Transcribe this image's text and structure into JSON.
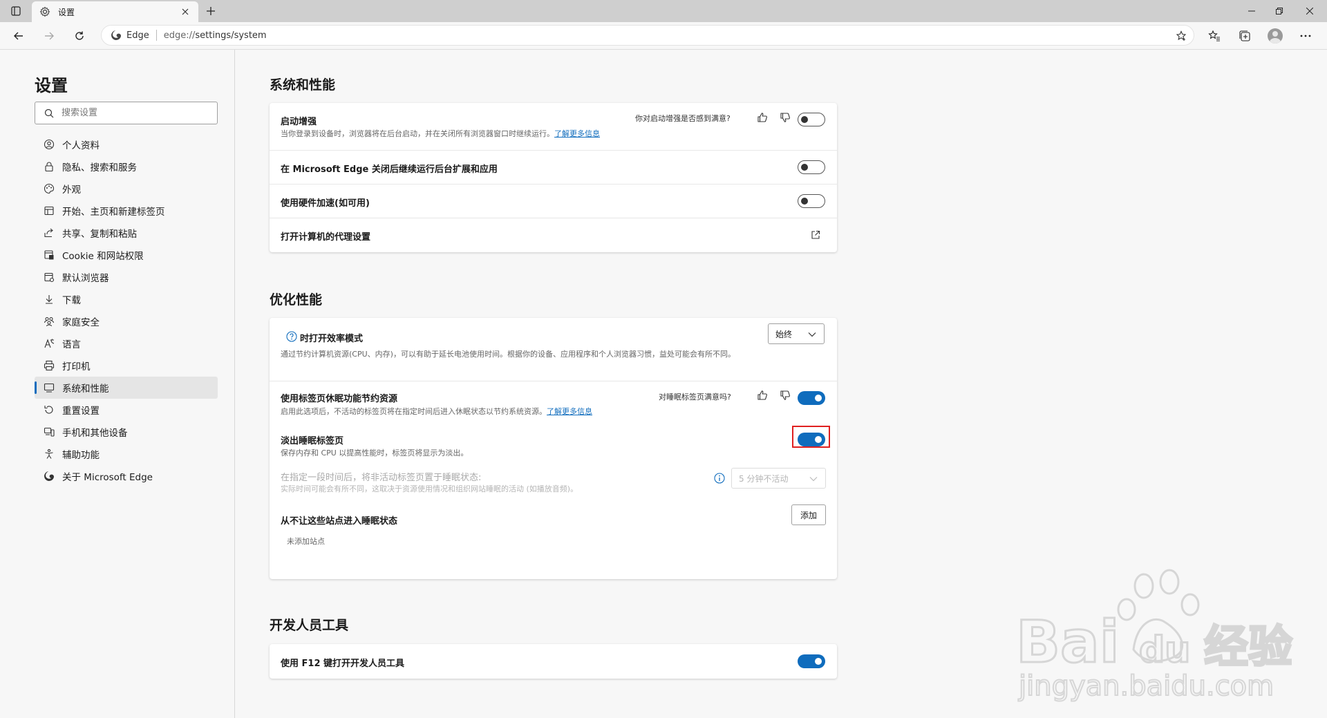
{
  "window": {
    "tab_title": "设置"
  },
  "toolbar": {
    "site_name": "Edge",
    "url_scheme": "edge://",
    "url_path": "settings/system"
  },
  "sidebar": {
    "heading": "设置",
    "search_placeholder": "搜索设置",
    "items": [
      {
        "label": "个人资料",
        "icon": "profile-icon"
      },
      {
        "label": "隐私、搜索和服务",
        "icon": "lock-icon"
      },
      {
        "label": "外观",
        "icon": "appearance-icon"
      },
      {
        "label": "开始、主页和新建标签页",
        "icon": "home-icon"
      },
      {
        "label": "共享、复制和粘贴",
        "icon": "share-icon"
      },
      {
        "label": "Cookie 和网站权限",
        "icon": "site-permissions-icon"
      },
      {
        "label": "默认浏览器",
        "icon": "browser-icon"
      },
      {
        "label": "下载",
        "icon": "download-icon"
      },
      {
        "label": "家庭安全",
        "icon": "family-icon"
      },
      {
        "label": "语言",
        "icon": "language-icon"
      },
      {
        "label": "打印机",
        "icon": "printer-icon"
      },
      {
        "label": "系统和性能",
        "icon": "system-icon",
        "active": true
      },
      {
        "label": "重置设置",
        "icon": "reset-icon"
      },
      {
        "label": "手机和其他设备",
        "icon": "phone-icon"
      },
      {
        "label": "辅助功能",
        "icon": "accessibility-icon"
      },
      {
        "label": "关于 Microsoft Edge",
        "icon": "edge-logo-icon"
      }
    ]
  },
  "sections": {
    "system": {
      "title": "系统和性能",
      "startup_boost": {
        "title": "启动增强",
        "desc": "当你登录到设备时，浏览器将在后台启动，并在关闭所有浏览器窗口时继续运行。",
        "link": "了解更多信息",
        "feedback": "你对启动增强是否感到满意?",
        "enabled": false
      },
      "background_run": {
        "title": "在 Microsoft Edge 关闭后继续运行后台扩展和应用",
        "enabled": false
      },
      "hardware_accel": {
        "title": "使用硬件加速(如可用)",
        "enabled": false
      },
      "proxy": {
        "title": "打开计算机的代理设置"
      }
    },
    "optimize": {
      "title": "优化性能",
      "efficiency": {
        "title": "时打开效率模式",
        "desc": "通过节约计算机资源(CPU、内存)，可以有助于延长电池使用时间。根据你的设备、应用程序和个人浏览器习惯，益处可能会有所不同。",
        "dropdown_value": "始终"
      },
      "sleeping_tabs": {
        "title": "使用标签页休眠功能节约资源",
        "desc": "启用此选项后，不活动的标签页将在指定时间后进入休眠状态以节约系统资源。",
        "link": "了解更多信息",
        "feedback": "对睡眠标签页满意吗?",
        "enabled": true
      },
      "fade_tabs": {
        "title": "淡出睡眠标签页",
        "desc": "保存内存和 CPU 以提高性能时，标签页将显示为淡出。",
        "enabled": true
      },
      "sleep_after": {
        "title": "在指定一段时间后，将非活动标签页置于睡眠状态:",
        "desc": "实际时间可能会有所不同，这取决于资源使用情况和组织网站睡眠的活动 (如播放音频)。",
        "dropdown_value": "5 分钟不活动"
      },
      "never_sleep": {
        "title": "从不让这些站点进入睡眠状态",
        "add_label": "添加",
        "empty_text": "未添加站点"
      }
    },
    "devtools": {
      "title": "开发人员工具",
      "f12": {
        "title": "使用 F12 键打开开发人员工具",
        "enabled": true
      }
    }
  },
  "watermark": {
    "brand": "Bai",
    "brand2": "du",
    "product": "经验",
    "url": "jingyan.baidu.com"
  },
  "colors": {
    "accent": "#0f6cbd",
    "highlight": "#e02020"
  }
}
